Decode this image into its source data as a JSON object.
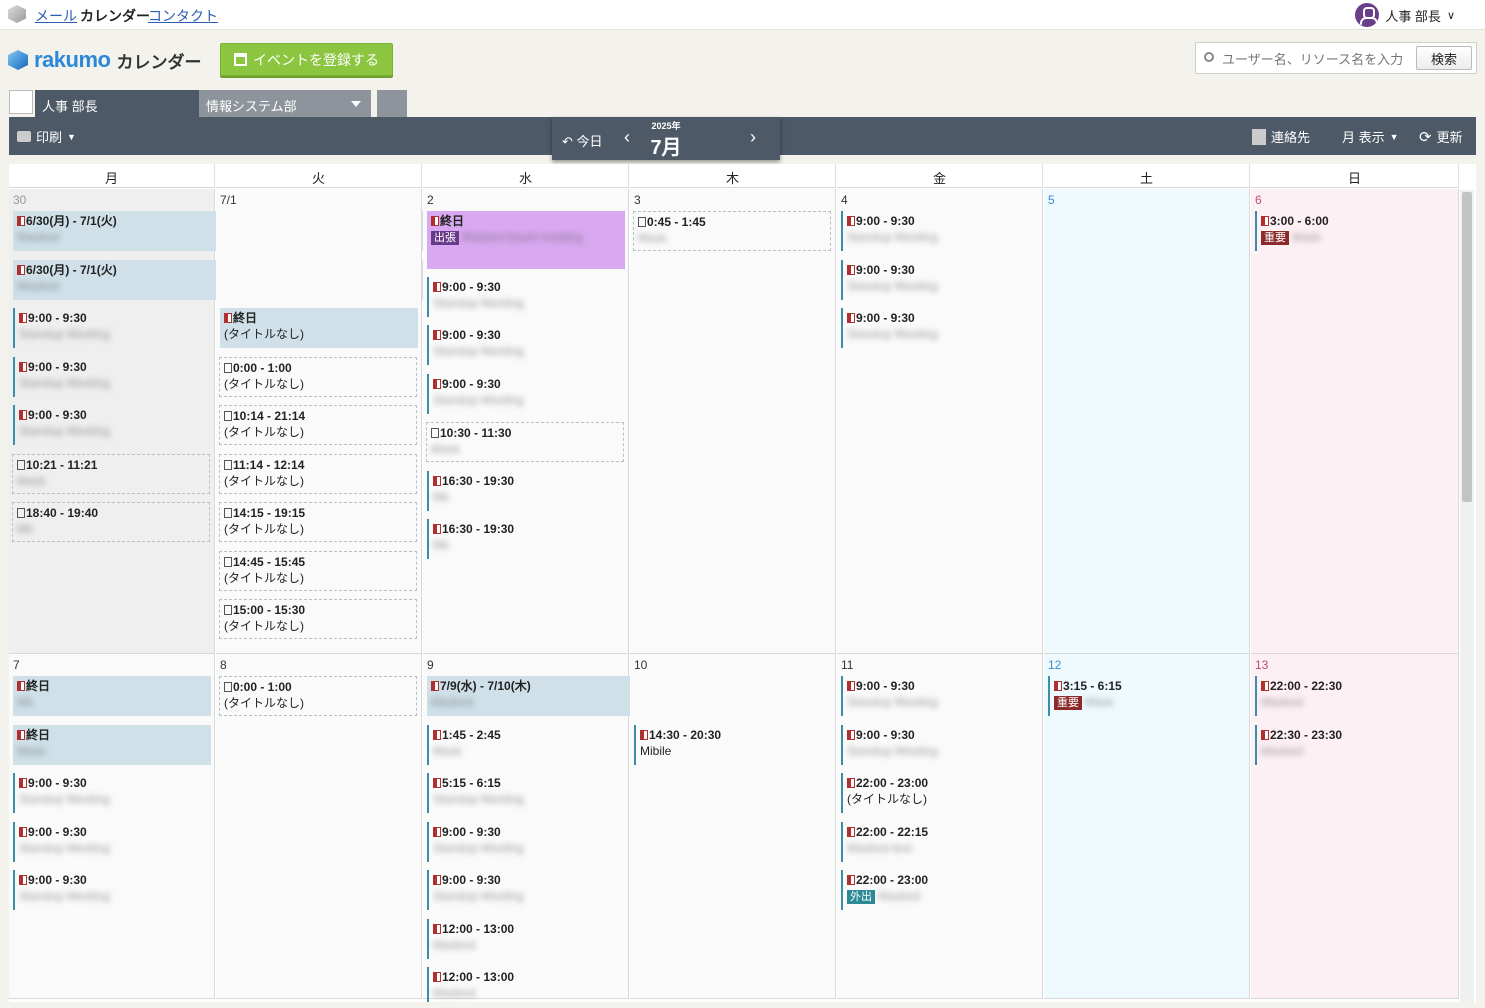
{
  "topnav": {
    "mail": "メール",
    "calendar": "カレンダー",
    "contacts": "コンタクト",
    "user": "人事 部長"
  },
  "app": {
    "logo": "rakumo",
    "name": "カレンダー",
    "register_button": "イベントを登録する",
    "search_placeholder": "ユーザー名、リソース名を入力",
    "search_button": "検索"
  },
  "tabs": {
    "active": "人事 部長",
    "group": "情報システム部"
  },
  "toolbar": {
    "print": "印刷",
    "today": "今日",
    "year": "2025年",
    "month": "7月",
    "contacts": "連絡先",
    "view": "月 表示",
    "refresh": "更新"
  },
  "colors": {
    "accent_green": "#8cc540",
    "toolbar": "#4d5966",
    "allday": "#cfe0e8",
    "saturday": "#eefafd",
    "sunday": "#fcf0f4"
  },
  "weekdays": [
    "月",
    "火",
    "水",
    "木",
    "金",
    "土",
    "日"
  ],
  "week1": {
    "days": [
      "30",
      "7/1",
      "2",
      "3",
      "4",
      "5",
      "6"
    ],
    "mon": [
      {
        "time": "6/30(月) - 7/1(火)",
        "sub": "Masked"
      },
      {
        "time": "6/30(月) - 7/1(火)",
        "sub": "Masked"
      },
      {
        "time": "9:00 - 9:30",
        "sub": "Standup Meeting"
      },
      {
        "time": "9:00 - 9:30",
        "sub": "Standup Meeting"
      },
      {
        "time": "9:00 - 9:30",
        "sub": "Standup Meeting"
      },
      {
        "time": "10:21 - 11:21",
        "sub": "Mask"
      },
      {
        "time": "18:40 - 19:40",
        "sub": "Mk"
      }
    ],
    "tue": [
      {
        "time": "終日",
        "sub": "(タイトルなし)"
      },
      {
        "time": "0:00 - 1:00",
        "sub": "(タイトルなし)"
      },
      {
        "time": "10:14 - 21:14",
        "sub": "(タイトルなし)"
      },
      {
        "time": "11:14 - 12:14",
        "sub": "(タイトルなし)"
      },
      {
        "time": "14:15 - 19:15",
        "sub": "(タイトルなし)"
      },
      {
        "time": "14:45 - 15:45",
        "sub": "(タイトルなし)"
      },
      {
        "time": "15:00 - 15:30",
        "sub": "(タイトルなし)"
      }
    ],
    "wed": [
      {
        "time": "終日",
        "tag": "出張",
        "sub": "Masked travel meeting"
      },
      {
        "time": "9:00 - 9:30",
        "sub": "Standup Meeting"
      },
      {
        "time": "9:00 - 9:30",
        "sub": "Standup Meeting"
      },
      {
        "time": "9:00 - 9:30",
        "sub": "Standup Meeting"
      },
      {
        "time": "10:30 - 11:30",
        "sub": "Mask"
      },
      {
        "time": "16:30 - 19:30",
        "sub": "Mk"
      },
      {
        "time": "16:30 - 19:30",
        "sub": "Mk"
      }
    ],
    "thu": [
      {
        "time": "0:45 - 1:45",
        "sub": "Mask"
      }
    ],
    "fri": [
      {
        "time": "9:00 - 9:30",
        "sub": "Standup Meeting"
      },
      {
        "time": "9:00 - 9:30",
        "sub": "Standup Meeting"
      },
      {
        "time": "9:00 - 9:30",
        "sub": "Standup Meeting"
      }
    ],
    "sun": [
      {
        "time": "3:00 - 6:00",
        "tag": "重要",
        "sub": "Mask"
      }
    ]
  },
  "week2": {
    "days": [
      "7",
      "8",
      "9",
      "10",
      "11",
      "12",
      "13"
    ],
    "mon": [
      {
        "time": "終日",
        "sub": "Mk"
      },
      {
        "time": "終日",
        "sub": "Mask"
      },
      {
        "time": "9:00 - 9:30",
        "sub": "Standup Meeting"
      },
      {
        "time": "9:00 - 9:30",
        "sub": "Standup Meeting"
      },
      {
        "time": "9:00 - 9:30",
        "sub": "Standup Meeting"
      }
    ],
    "tue": [
      {
        "time": "0:00 - 1:00",
        "sub": "(タイトルなし)"
      }
    ],
    "wed": [
      {
        "time": "7/9(水) - 7/10(木)",
        "sub": "Masked"
      },
      {
        "time": "1:45 - 2:45",
        "sub": "Mask"
      },
      {
        "time": "5:15 - 6:15",
        "sub": "Standup Meeting"
      },
      {
        "time": "9:00 - 9:30",
        "sub": "Standup Meeting"
      },
      {
        "time": "9:00 - 9:30",
        "sub": "Standup Meeting"
      },
      {
        "time": "12:00 - 13:00",
        "sub": "Masked"
      },
      {
        "time": "12:00 - 13:00",
        "sub": "Masked"
      }
    ],
    "thu": [
      {
        "time": "14:30 - 20:30",
        "sub": "Mibile"
      }
    ],
    "fri": [
      {
        "time": "9:00 - 9:30",
        "sub": "Standup Meeting"
      },
      {
        "time": "9:00 - 9:30",
        "sub": "Standup Meeting"
      },
      {
        "time": "22:00 - 23:00",
        "sub": "(タイトルなし)"
      },
      {
        "time": "22:00 - 22:15",
        "sub": "Masked text"
      },
      {
        "time": "22:00 - 23:00",
        "tag": "外出",
        "sub": "Masked"
      }
    ],
    "sat": [
      {
        "time": "3:15 - 6:15",
        "tag": "重要",
        "sub": "Mask"
      }
    ],
    "sun": [
      {
        "time": "22:00 - 22:30",
        "sub": "Masked"
      },
      {
        "time": "22:30 - 23:30",
        "sub": "Masked"
      }
    ]
  }
}
